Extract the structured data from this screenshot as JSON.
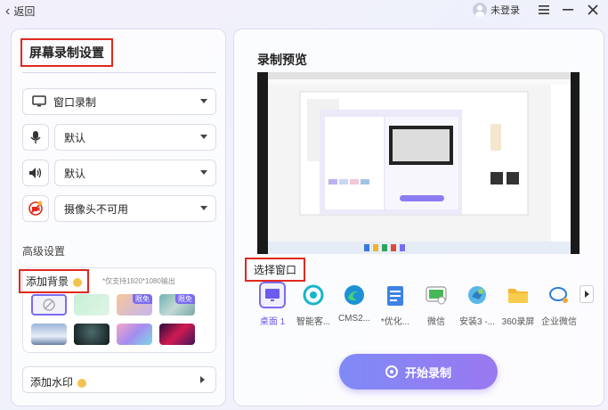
{
  "titlebar": {
    "back_label": "返回",
    "user_label": "未登录"
  },
  "left": {
    "title": "屏幕录制设置",
    "mode_select": "窗口录制",
    "mic_select": "默认",
    "speaker_select": "默认",
    "camera_select": "摄像头不可用",
    "advanced_label": "高级设置",
    "bg_title": "添加背景",
    "bg_note": "*仅支持1920*1080输出",
    "thumb_badge": "限免",
    "watermark_label": "添加水印"
  },
  "right": {
    "title": "录制预览",
    "select_window_title": "选择窗口",
    "apps": [
      {
        "label": "桌面 1",
        "icon": "monitor-icon"
      },
      {
        "label": "智能客...",
        "icon": "chat-app-icon"
      },
      {
        "label": "CMS2...",
        "icon": "edge-icon"
      },
      {
        "label": "*优化...",
        "icon": "notepad-icon"
      },
      {
        "label": "微信",
        "icon": "wechat-icon"
      },
      {
        "label": "安装3 -...",
        "icon": "installer-icon"
      },
      {
        "label": "360录屏",
        "icon": "folder-icon"
      },
      {
        "label": "企业微信",
        "icon": "wecom-icon"
      }
    ],
    "start_label": "开始录制"
  },
  "colors": {
    "accent": "#7a6cf0",
    "highlight": "#e0281e",
    "start_gradient_from": "#7f8af7",
    "start_gradient_to": "#9a78f0"
  }
}
